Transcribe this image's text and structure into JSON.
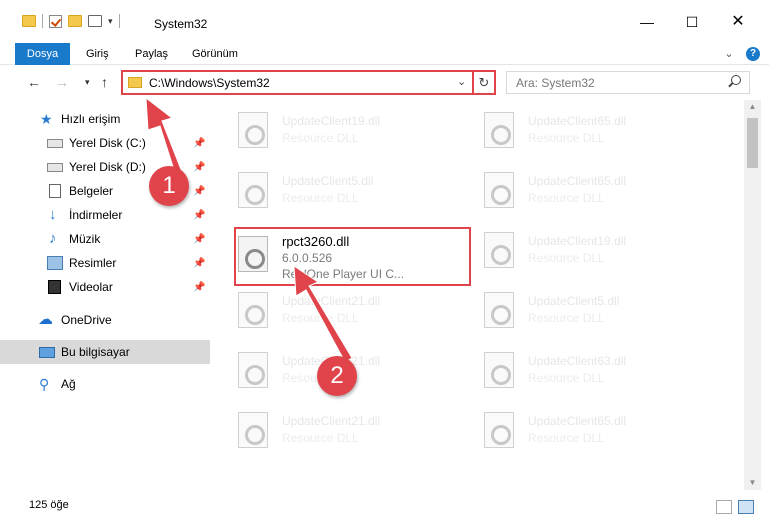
{
  "window": {
    "title": "System32",
    "minimize_glyph": "—",
    "maximize_glyph": "☐",
    "close_glyph": "✕"
  },
  "ribbon": {
    "tabs": [
      "Dosya",
      "Giriş",
      "Paylaş",
      "Görünüm"
    ],
    "expand_glyph": "⌄",
    "help_glyph": "?"
  },
  "nav": {
    "back_glyph": "←",
    "forward_glyph": "→",
    "recent_glyph": "▾",
    "up_glyph": "↑",
    "address": "C:\\Windows\\System32",
    "address_dropdown_glyph": "⌄",
    "refresh_glyph": "↻",
    "search_placeholder": "Ara: System32"
  },
  "sidebar": {
    "items": [
      {
        "label": "Hızlı erişim",
        "icon": "star-icon",
        "glyph": "★",
        "pinned": false
      },
      {
        "label": "Yerel Disk (C:)",
        "icon": "drive-icon",
        "pinned": true
      },
      {
        "label": "Yerel Disk (D:)",
        "icon": "drive-icon",
        "pinned": true
      },
      {
        "label": "Belgeler",
        "icon": "document-icon",
        "pinned": true
      },
      {
        "label": "İndirmeler",
        "icon": "download-icon",
        "glyph": "↓",
        "pinned": true
      },
      {
        "label": "Müzik",
        "icon": "music-icon",
        "glyph": "♪",
        "pinned": true
      },
      {
        "label": "Resimler",
        "icon": "pictures-icon",
        "pinned": true
      },
      {
        "label": "Videolar",
        "icon": "video-icon",
        "pinned": true
      },
      {
        "label": "OneDrive",
        "icon": "cloud-icon",
        "glyph": "☁",
        "pinned": false
      },
      {
        "label": "Bu bilgisayar",
        "icon": "computer-icon",
        "pinned": false,
        "selected": true
      },
      {
        "label": "Ağ",
        "icon": "network-icon",
        "glyph": "⚲",
        "pinned": false
      }
    ],
    "pin_glyph": "📌"
  },
  "files": {
    "left": [
      {
        "name": "UpdateClient19.dll",
        "desc": "Resource DLL"
      },
      {
        "name": "UpdateClient5.dll",
        "desc": "Resource DLL"
      },
      {
        "name": "rpct3260.dll",
        "version": "6.0.0.526",
        "desc": "RealOne Player UI C...",
        "highlighted": true
      },
      {
        "name": "UpdateClient21.dll",
        "desc": "Resource DLL"
      },
      {
        "name": "UpdateClient21.dll",
        "desc": "Resource DLL"
      },
      {
        "name": "UpdateClient21.dll",
        "desc": "Resource DLL"
      }
    ],
    "right": [
      {
        "name": "UpdateClient65.dll",
        "desc": "Resource DLL"
      },
      {
        "name": "UpdateClient65.dll",
        "desc": "Resource DLL"
      },
      {
        "name": "UpdateClient19.dll",
        "desc": "Resource DLL"
      },
      {
        "name": "UpdateClient5.dll",
        "desc": "Resource DLL"
      },
      {
        "name": "UpdateClient63.dll",
        "desc": "Resource DLL"
      },
      {
        "name": "UpdateClient65.dll",
        "desc": "Resource DLL"
      }
    ]
  },
  "status": {
    "item_count": "125 öğe"
  },
  "annotations": {
    "step1": "1",
    "step2": "2",
    "color": "#e0434a"
  }
}
